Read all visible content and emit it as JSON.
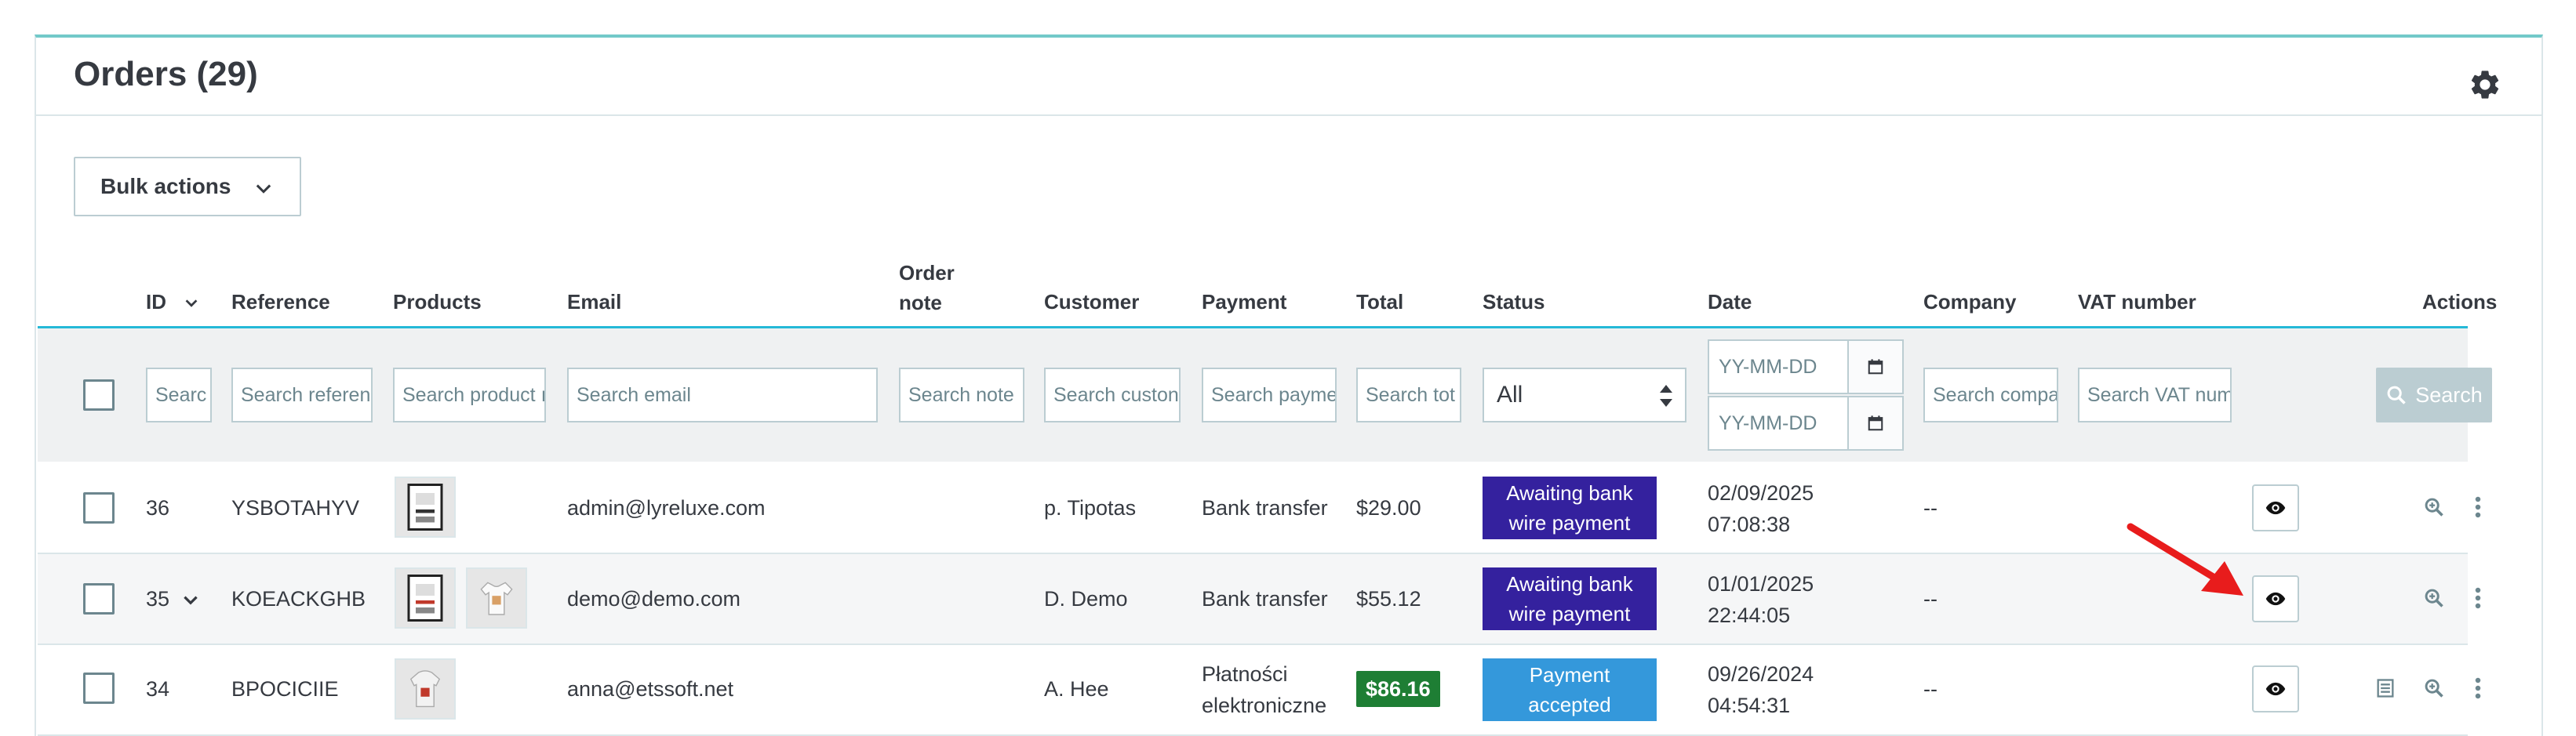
{
  "header": {
    "title": "Orders",
    "count": "(29)"
  },
  "toolbar": {
    "bulk_label": "Bulk actions"
  },
  "columns": {
    "id": "ID",
    "reference": "Reference",
    "products": "Products",
    "email": "Email",
    "order_note_line1": "Order",
    "order_note_line2": "note",
    "customer": "Customer",
    "payment": "Payment",
    "total": "Total",
    "status": "Status",
    "date": "Date",
    "company": "Company",
    "vat": "VAT number",
    "actions": "Actions"
  },
  "filters": {
    "id": "Searc",
    "reference": "Search referen",
    "products": "Search product ı",
    "email": "Search email",
    "order_note": "Search note",
    "customer": "Search custon",
    "payment": "Search payme",
    "total": "Search tot",
    "status": "All",
    "date_from": "YY-MM-DD",
    "date_to": "YY-MM-DD",
    "company": "Search compa",
    "vat": "Search VAT num",
    "search_button": "Search"
  },
  "rows": [
    {
      "id": "36",
      "reference": "YSBOTAHYV",
      "email": "admin@lyreluxe.com",
      "customer": "p. Tipotas",
      "payment_line1": "Bank transfer",
      "payment_line2": "",
      "total": "$29.00",
      "status_line1": "Awaiting bank",
      "status_line2": "wire payment",
      "date": "02/09/2025",
      "time": "07:08:38",
      "company": "--"
    },
    {
      "id": "35",
      "reference": "KOEACKGHB",
      "email": "demo@demo.com",
      "customer": "D. Demo",
      "payment_line1": "Bank transfer",
      "payment_line2": "",
      "total": "$55.12",
      "status_line1": "Awaiting bank",
      "status_line2": "wire payment",
      "date": "01/01/2025",
      "time": "22:44:05",
      "company": "--"
    },
    {
      "id": "34",
      "reference": "BPOCICIIE",
      "email": "anna@etssoft.net",
      "customer": "A. Hee",
      "payment_line1": "Płatności",
      "payment_line2": "elektroniczne",
      "total": "$86.16",
      "status_line1": "Payment",
      "status_line2": "accepted",
      "date": "09/26/2024",
      "time": "04:54:31",
      "company": "--"
    }
  ],
  "colors": {
    "accent_teal": "#72c9c9",
    "awaiting_status": "#34219e",
    "accepted_status": "#3498db",
    "total_badge": "#1e7e34",
    "arrow": "#e81c1c"
  }
}
